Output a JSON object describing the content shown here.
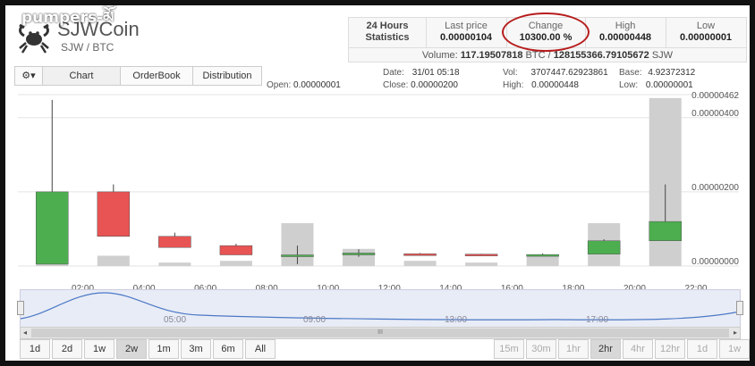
{
  "watermark": "pumpers-མོ",
  "coin": {
    "name": "SJWCoin",
    "pair": "SJW / BTC"
  },
  "stats": {
    "heading_line1": "24 Hours",
    "heading_line2": "Statistics",
    "last_price": {
      "label": "Last price",
      "value": "0.00000104"
    },
    "change": {
      "label": "Change",
      "value": "10300.00 %"
    },
    "high": {
      "label": "High",
      "value": "0.00000448"
    },
    "low": {
      "label": "Low",
      "value": "0.00000001"
    },
    "volume_label": "Volume:",
    "volume_btc": "117.19507818",
    "volume_btc_unit": "BTC /",
    "volume_sjw": "128155366.79105672",
    "volume_sjw_unit": "SJW"
  },
  "tabs": [
    "Chart",
    "OrderBook",
    "Distribution"
  ],
  "info": {
    "open_label": "Open:",
    "open": "0.00000001",
    "date_label": "Date:",
    "date": "31/01 05:18",
    "close_label": "Close:",
    "close": "0.00000200",
    "vol_label": "Vol:",
    "vol": "3707447.62923861",
    "high_label": "High:",
    "high": "0.00000448",
    "base_label": "Base:",
    "base": "4.92372312",
    "low_label": "Low:",
    "low": "0.00000001"
  },
  "colors": {
    "up": "#4cae4f",
    "down": "#e85353",
    "volume": "#cfcfcf",
    "highlight": "#b71c1c"
  },
  "chart_data": {
    "type": "candlestick",
    "x_ticks": [
      "02:00",
      "04:00",
      "06:00",
      "08:00",
      "10:00",
      "12:00",
      "14:00",
      "16:00",
      "18:00",
      "20:00",
      "22:00"
    ],
    "y_ticks": [
      "0.00000000",
      "0.00000200",
      "0.00000400",
      "0.00000462"
    ],
    "ylim": [
      0,
      4.62e-06
    ],
    "candles": [
      {
        "t": "01:00",
        "o": 5e-08,
        "h": 4.48e-06,
        "l": 5e-08,
        "c": 2e-06,
        "vol": 0.04
      },
      {
        "t": "03:00",
        "o": 2e-06,
        "h": 2.2e-06,
        "l": 8e-07,
        "c": 8e-07,
        "vol": 0.06
      },
      {
        "t": "05:00",
        "o": 8e-07,
        "h": 9e-07,
        "l": 5e-07,
        "c": 5e-07,
        "vol": 0.02
      },
      {
        "t": "07:00",
        "o": 5.5e-07,
        "h": 6e-07,
        "l": 3e-07,
        "c": 3e-07,
        "vol": 0.03
      },
      {
        "t": "09:00",
        "o": 2.7e-07,
        "h": 5.5e-07,
        "l": 5e-08,
        "c": 3e-07,
        "vol": 0.25
      },
      {
        "t": "11:00",
        "o": 3e-07,
        "h": 4.5e-07,
        "l": 2.5e-07,
        "c": 3.5e-07,
        "vol": 0.1
      },
      {
        "t": "13:00",
        "o": 3.3e-07,
        "h": 3.5e-07,
        "l": 3e-07,
        "c": 3.1e-07,
        "vol": 0.03
      },
      {
        "t": "15:00",
        "o": 3.2e-07,
        "h": 3.3e-07,
        "l": 2.9e-07,
        "c": 3e-07,
        "vol": 0.02
      },
      {
        "t": "17:00",
        "o": 3e-07,
        "h": 3.4e-07,
        "l": 2.7e-07,
        "c": 3.1e-07,
        "vol": 0.06
      },
      {
        "t": "19:00",
        "o": 3.2e-07,
        "h": 7.2e-07,
        "l": 3.2e-07,
        "c": 6.8e-07,
        "vol": 0.25
      },
      {
        "t": "21:00",
        "o": 6.8e-07,
        "h": 2.2e-06,
        "l": 6.8e-07,
        "c": 1.2e-06,
        "vol": 0.98
      }
    ]
  },
  "navigator": {
    "labels": [
      "05:00",
      "09:00",
      "13:00",
      "17:00"
    ],
    "scroll_grip": "III"
  },
  "ranges": [
    "1d",
    "2d",
    "1w",
    "2w",
    "1m",
    "3m",
    "6m",
    "All"
  ],
  "active_range": "2w",
  "periods": [
    "15m",
    "30m",
    "1hr",
    "2hr",
    "4hr",
    "12hr",
    "1d",
    "1w"
  ],
  "active_period": "2hr"
}
